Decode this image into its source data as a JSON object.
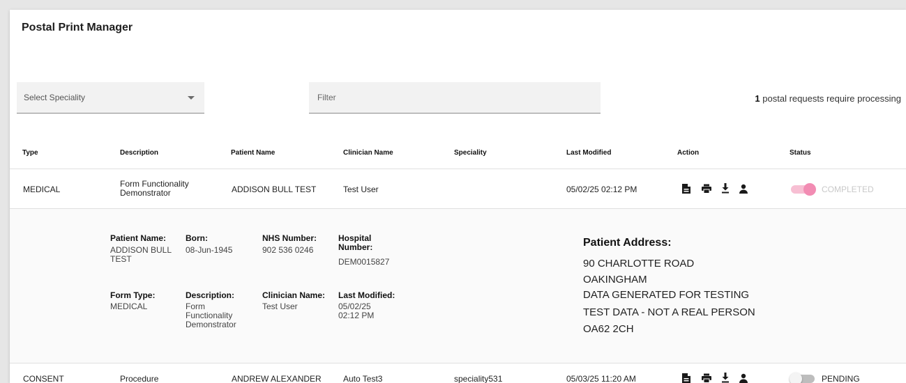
{
  "title": "Postal Print Manager",
  "speciality_select": {
    "placeholder": "Select Speciality"
  },
  "filter": {
    "placeholder": "Filter"
  },
  "counter": {
    "count": "1",
    "text": "postal requests require processing"
  },
  "columns": {
    "type": "Type",
    "description": "Description",
    "patient_name": "Patient Name",
    "clinician_name": "Clinician Name",
    "speciality": "Speciality",
    "last_modified": "Last Modified",
    "action": "Action",
    "status": "Status"
  },
  "rows": [
    {
      "type": "MEDICAL",
      "description": "Form Functionality Demonstrator",
      "patient_name": "ADDISON BULL TEST",
      "clinician_name": "Test User",
      "speciality": "",
      "last_modified": "05/02/25 02:12 PM",
      "status": "COMPLETED",
      "status_on": true,
      "status_color": "#f28cb3"
    },
    {
      "type": "CONSENT",
      "description": "Procedure",
      "patient_name": "ANDREW ALEXANDER",
      "clinician_name": "Auto Test3",
      "speciality": "speciality531",
      "last_modified": "05/03/25 11:20 AM",
      "status": "PENDING",
      "status_on": false,
      "status_color": "#222222"
    }
  ],
  "action_icons": [
    "document-icon",
    "print-icon",
    "download-icon",
    "person-icon"
  ],
  "detail": {
    "labels": {
      "patient_name": "Patient Name:",
      "born": "Born:",
      "nhs_number": "NHS Number:",
      "hospital_number": "Hospital Number:",
      "form_type": "Form Type:",
      "description": "Description:",
      "clinician_name": "Clinician Name:",
      "last_modified": "Last Modified:",
      "patient_address": "Patient Address:"
    },
    "values": {
      "patient_name": "ADDISON BULL TEST",
      "born": "08-Jun-1945",
      "nhs_number": "902 536 0246",
      "hospital_number": "DEM0015827",
      "form_type": "MEDICAL",
      "description": "Form Functionality Demonstrator",
      "clinician_name": "Test User",
      "last_modified": "05/02/25 02:12 PM"
    },
    "address": [
      "90 CHARLOTTE ROAD",
      "OAKINGHAM",
      "DATA GENERATED FOR TESTING",
      "TEST DATA - NOT A REAL PERSON",
      "OA62 2CH"
    ]
  },
  "colors": {
    "accent_pink": "#f28cb3",
    "accent_pink_light": "#f7bfd3",
    "toggle_off": "#bdbdbd"
  }
}
